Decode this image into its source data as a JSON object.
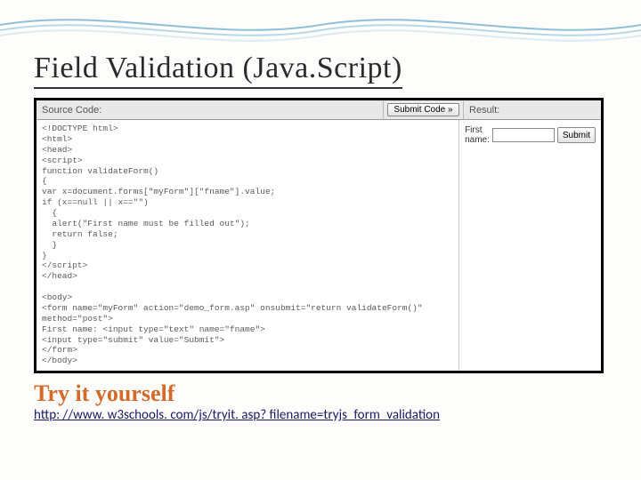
{
  "title": "Field Validation (Java.Script)",
  "editor": {
    "source_label": "Source Code:",
    "submit_btn": "Submit Code »",
    "result_label": "Result:",
    "code": "<!DOCTYPE html>\n<html>\n<head>\n<script>\nfunction validateForm()\n{\nvar x=document.forms[\"myForm\"][\"fname\"].value;\nif (x==null || x==\"\")\n  {\n  alert(\"First name must be filled out\");\n  return false;\n  }\n}\n</script>\n</head>\n\n<body>\n<form name=\"myForm\" action=\"demo_form.asp\" onsubmit=\"return validateForm()\"\nmethod=\"post\">\nFirst name: <input type=\"text\" name=\"fname\">\n<input type=\"submit\" value=\"Submit\">\n</form>\n</body>\n\n</html>"
  },
  "result": {
    "label": "First name:",
    "input_value": "",
    "submit_label": "Submit"
  },
  "try_heading": "Try it yourself",
  "url": "http: //www. w3schools. com/js/tryit. asp? filename=tryjs_form_validation"
}
